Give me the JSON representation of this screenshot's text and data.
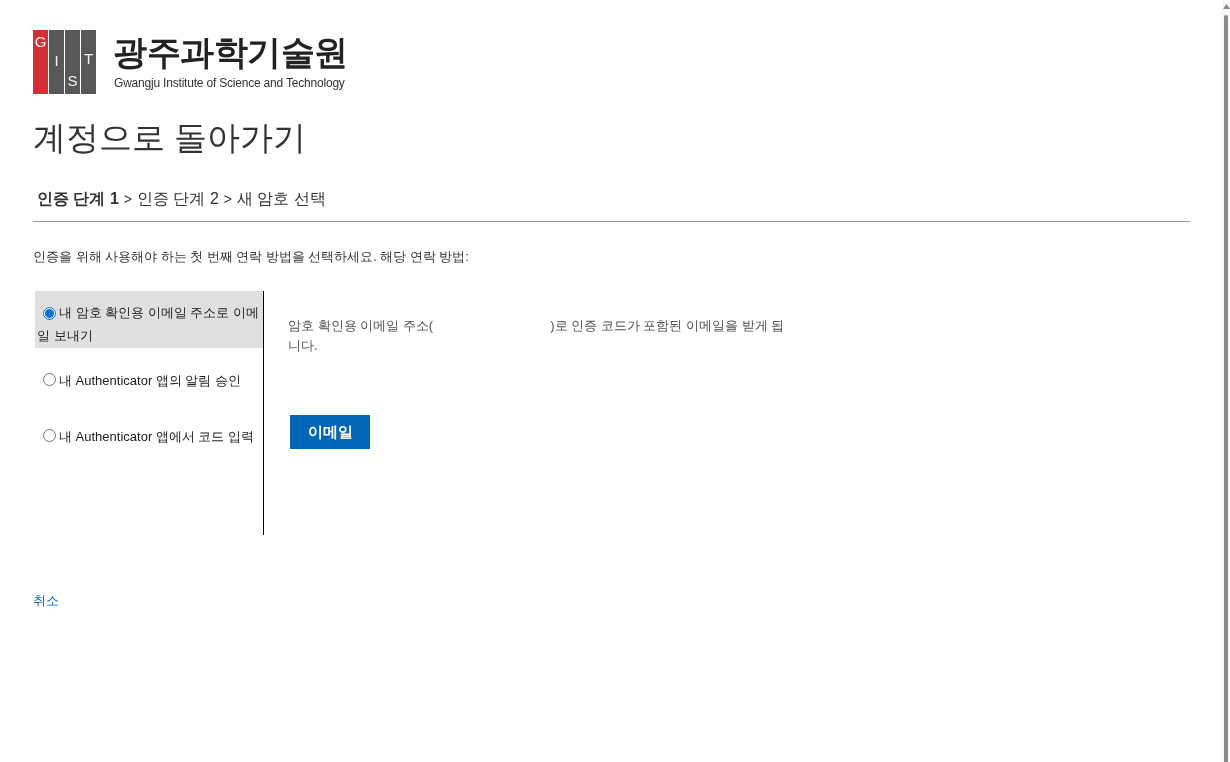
{
  "logo": {
    "letters": [
      {
        "letter": "G",
        "color": "#d32f34"
      },
      {
        "letter": "I",
        "color": "#565957"
      },
      {
        "letter": "S",
        "color": "#565957"
      },
      {
        "letter": "T",
        "color": "#565957"
      }
    ],
    "name": "광주과학기술원",
    "subtitle": "Gwangju Institute of Science and Technology"
  },
  "title": "계정으로 돌아가기",
  "breadcrumb": {
    "steps": [
      {
        "label": "인증 단계 1",
        "selected": true
      },
      {
        "label": "인증 단계 2",
        "selected": false
      },
      {
        "label": "새 암호 선택",
        "selected": false
      }
    ],
    "separators": [
      ">",
      ">"
    ]
  },
  "instruction": "인증을 위해 사용해야 하는 첫 번째 연락 방법을 선택하세요. 해당 연락 방법:",
  "options": [
    {
      "label": "내 암호 확인용 이메일 주소로 이메일 보내기",
      "selected": true
    },
    {
      "label": "내 Authenticator 앱의 알림 승인",
      "selected": false
    },
    {
      "label": "내 Authenticator 앱에서 코드 입력",
      "selected": false
    }
  ],
  "detail": {
    "text_before": "암호 확인용 이메일 주소(",
    "text_after": ")로 인증 코드가 포함된 이메일을 받게 됩니다."
  },
  "action_button": "이메일",
  "cancel_link": "취소"
}
